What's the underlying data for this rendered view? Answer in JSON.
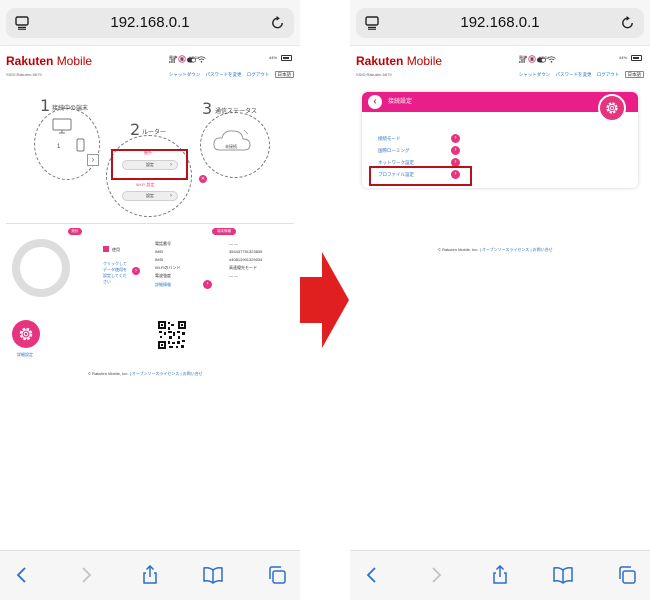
{
  "browser": {
    "url": "192.168.0.1"
  },
  "header": {
    "logo_brand": "Rakuten",
    "logo_product": "Mobile",
    "ssid": "SSID:Rakuten-5679",
    "status": {
      "roaming": "圏外",
      "carrier": "KDDI",
      "battery_pct": "44%"
    },
    "nav": {
      "shutdown": "シャットダウン",
      "change_password": "パスワードを変更",
      "logout": "ログアウト",
      "language": "日本語"
    }
  },
  "left": {
    "step1": {
      "num": "1",
      "label": "接続中の端末",
      "pc_count": "1"
    },
    "step2": {
      "num": "2",
      "label": "ルーター",
      "status": "圏外",
      "settings_button": "設定",
      "wifi_label": "Wi-Fi 設定",
      "settings_button_2": "設定"
    },
    "step3": {
      "num": "3",
      "label": "通信ステータス",
      "cloud_label": "未接続"
    },
    "stats_tag": "統計",
    "device_tag": "端末情報",
    "legend_used": "使用",
    "data_plan_text_1": "クリックして",
    "data_plan_text_2": "データ使用を",
    "data_plan_text_3": "設定してくだ",
    "data_plan_text_4": "さい",
    "device_info": [
      {
        "label": "電話番号",
        "value": "— —"
      },
      {
        "label": "IMEI",
        "value": "354437751323835"
      },
      {
        "label": "IMSI",
        "value": "440812901329034"
      },
      {
        "label": "Wi-Fiのバンド",
        "value": "高速優先モード"
      },
      {
        "label": "電波強度",
        "value": "— —"
      }
    ],
    "details_link": "詳細情報",
    "advanced_settings": "詳細設定"
  },
  "right": {
    "card_title": "接続設定",
    "menu": [
      {
        "label": "接続モード"
      },
      {
        "label": "国際ローミング"
      },
      {
        "label": "ネットワーク設定"
      },
      {
        "label": "プロファイル設定"
      }
    ]
  },
  "footer": {
    "copyright": "© Rakuten Mobile, Inc.",
    "sep": "|",
    "oss": "オープンソースライセンス",
    "contact": "お問い合せ"
  },
  "colors": {
    "brand_red": "#bf0000",
    "accent_pink": "#e7347f",
    "card_header": "#e91e88",
    "link_blue": "#2a6fc9",
    "highlight_box": "#b5121b",
    "arrow_red": "#e02020"
  }
}
